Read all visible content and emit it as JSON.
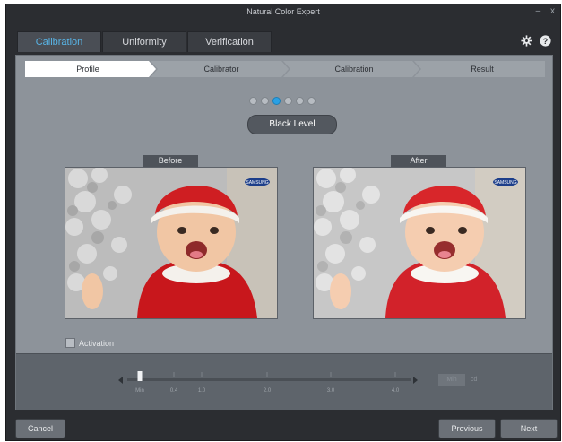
{
  "window": {
    "title": "Natural Color Expert",
    "minimize_glyph": "–",
    "close_glyph": "x"
  },
  "tabs": [
    {
      "label": "Calibration",
      "active": true
    },
    {
      "label": "Uniformity",
      "active": false
    },
    {
      "label": "Verification",
      "active": false
    }
  ],
  "tools": {
    "settings_icon": "gear-icon",
    "help_icon": "help-icon"
  },
  "steps": [
    {
      "label": "Profile",
      "active": true
    },
    {
      "label": "Calibrator",
      "active": false
    },
    {
      "label": "Calibration",
      "active": false
    },
    {
      "label": "Result",
      "active": false
    }
  ],
  "pager": {
    "count": 6,
    "active_index": 2
  },
  "level_title": "Black Level",
  "before": {
    "label": "Before",
    "logo": "SAMSUNG"
  },
  "after": {
    "label": "After",
    "logo": "SAMSUNG"
  },
  "activation": {
    "label": "Activation",
    "checked": false
  },
  "slider": {
    "ticks": [
      "Min",
      "0.4",
      "1.0",
      "2.0",
      "3.0",
      "4.0"
    ],
    "handle_position": 0,
    "value": "Min",
    "unit": "cd"
  },
  "footer": {
    "cancel": "Cancel",
    "previous": "Previous",
    "next": "Next"
  },
  "colors": {
    "accent": "#2aa0e4",
    "active_tab_text": "#58b4e6",
    "window_bg": "#2b2d31",
    "content_bg": "#8d939a"
  }
}
